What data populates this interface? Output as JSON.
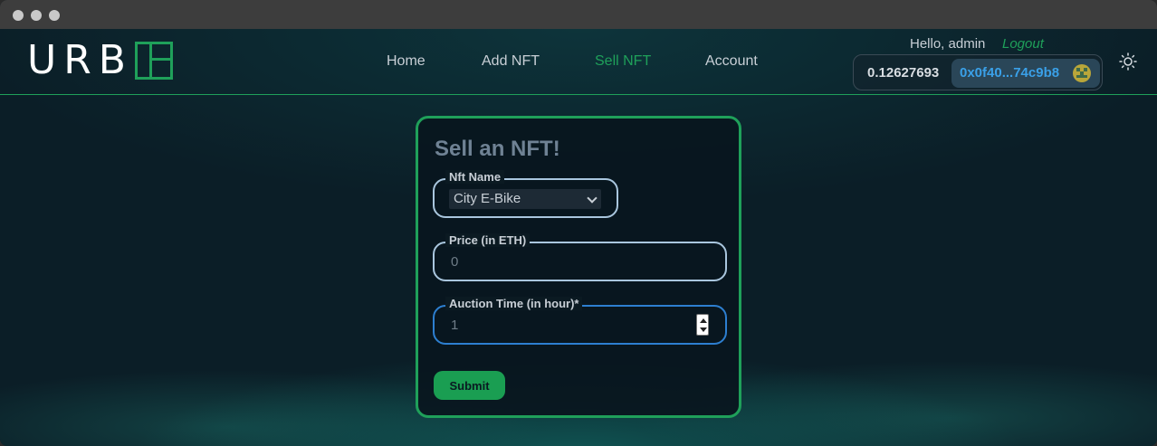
{
  "brand": {
    "logo_text": "URB",
    "accent_color": "#1fa05a"
  },
  "nav": {
    "links": [
      {
        "label": "Home",
        "active": false
      },
      {
        "label": "Add NFT",
        "active": false
      },
      {
        "label": "Sell NFT",
        "active": true
      },
      {
        "label": "Account",
        "active": false
      }
    ]
  },
  "user": {
    "greeting": "Hello, admin",
    "logout_label": "Logout"
  },
  "wallet": {
    "balance": "0.12627693",
    "address": "0x0f40...74c9b8",
    "avatar_icon": "identicon"
  },
  "theme_toggle": {
    "icon": "sun-icon"
  },
  "form": {
    "title": "Sell an NFT!",
    "nft_name": {
      "label": "Nft Name",
      "value": "City E-Bike"
    },
    "price": {
      "label": "Price (in ETH)",
      "placeholder": "0"
    },
    "auction_time": {
      "label": "Auction Time (in hour)*",
      "value": "1"
    },
    "submit_label": "Submit"
  }
}
